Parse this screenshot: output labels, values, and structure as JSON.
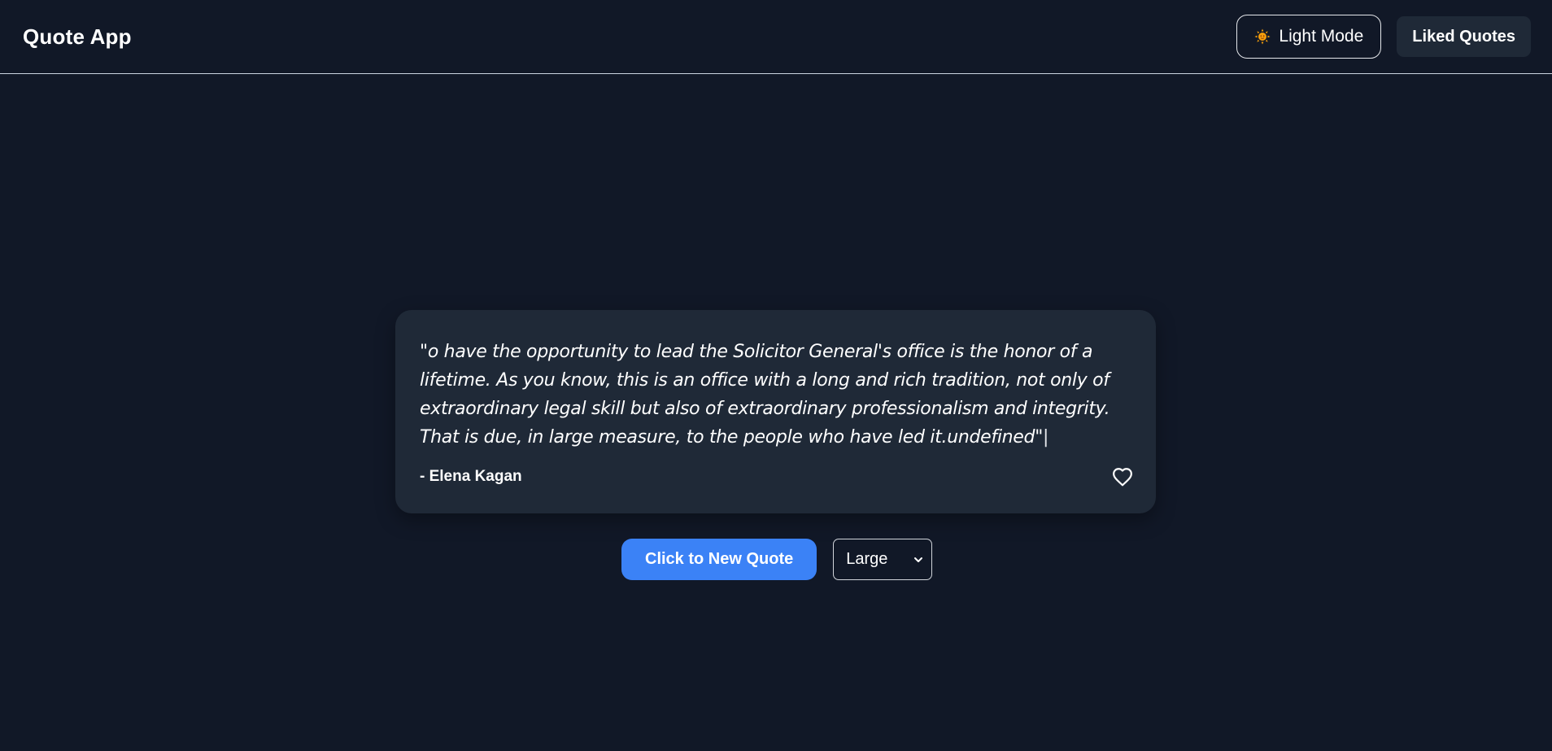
{
  "header": {
    "title": "Quote App",
    "theme_button_label": "Light Mode",
    "liked_button_label": "Liked Quotes",
    "theme_icon": "sun-icon"
  },
  "quote": {
    "text": "\"o have the opportunity to lead the Solicitor General's office is the honor of a lifetime. As you know, this is an office with a long and rich tradition, not only of extraordinary legal skill but also of extraordinary professionalism and integrity. That is due, in large measure, to the people who have led it.undefined\"",
    "cursor": "|",
    "author": "- Elena Kagan",
    "like_icon": "heart-outline-icon",
    "liked": false
  },
  "controls": {
    "new_quote_label": "Click to New Quote",
    "size_select": {
      "selected": "Large",
      "icon": "chevron-down-icon"
    }
  },
  "colors": {
    "background": "#111827",
    "card": "#1f2937",
    "accent": "#3b82f6",
    "text": "#ffffff"
  }
}
